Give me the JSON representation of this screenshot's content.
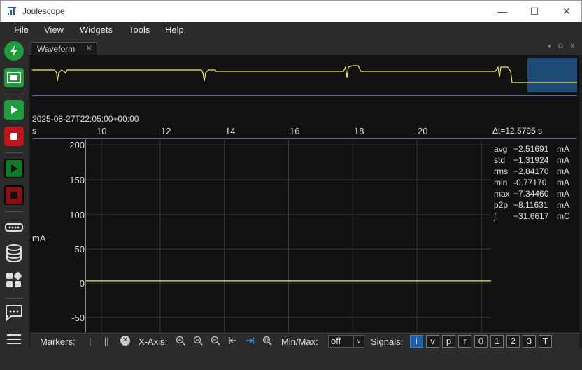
{
  "window": {
    "title": "Joulescope",
    "minimize": "—",
    "maximize": "☐",
    "close": "✕"
  },
  "menu": [
    "File",
    "View",
    "Widgets",
    "Tools",
    "Help"
  ],
  "tab": {
    "label": "Waveform",
    "close": "✕"
  },
  "dock_controls": [
    "▾",
    "⧉",
    "✕"
  ],
  "colors": {
    "signal": "#f2ee55",
    "marker_region": "#1e4b78",
    "separator": "#6a5e8a",
    "active_signal": "#1f5fa8"
  },
  "waveform": {
    "timestamp": "2025-08-27T22:05:00+00:00",
    "x_unit": "s",
    "x_ticks": [
      "10",
      "12",
      "14",
      "16",
      "18",
      "20"
    ],
    "delta_t": "Δt=12.5795 s",
    "y_unit": "mA",
    "y_ticks": [
      "200",
      "150",
      "100",
      "50",
      "0",
      "-50"
    ],
    "stats": [
      {
        "label": "avg",
        "value": "+2.51691",
        "unit": "mA"
      },
      {
        "label": "std",
        "value": "+1.31924",
        "unit": "mA"
      },
      {
        "label": "rms",
        "value": "+2.84170",
        "unit": "mA"
      },
      {
        "label": "min",
        "value": "-0.77170",
        "unit": "mA"
      },
      {
        "label": "max",
        "value": "+7.34460",
        "unit": "mA"
      },
      {
        "label": "p2p",
        "value": "+8.11631",
        "unit": "mA"
      },
      {
        "label": "∫",
        "value": "+31.6617",
        "unit": "mC"
      }
    ]
  },
  "toolbar": {
    "markers_label": "Markers:",
    "marker_single": "|",
    "marker_dual": "||",
    "marker_clear": "✕",
    "xaxis_label": "X-Axis:",
    "minmax_label": "Min/Max:",
    "minmax_value": "off",
    "signals_label": "Signals:",
    "signals": [
      "i",
      "v",
      "p",
      "r",
      "0",
      "1",
      "2",
      "3",
      "T"
    ],
    "active_signal": "i"
  }
}
